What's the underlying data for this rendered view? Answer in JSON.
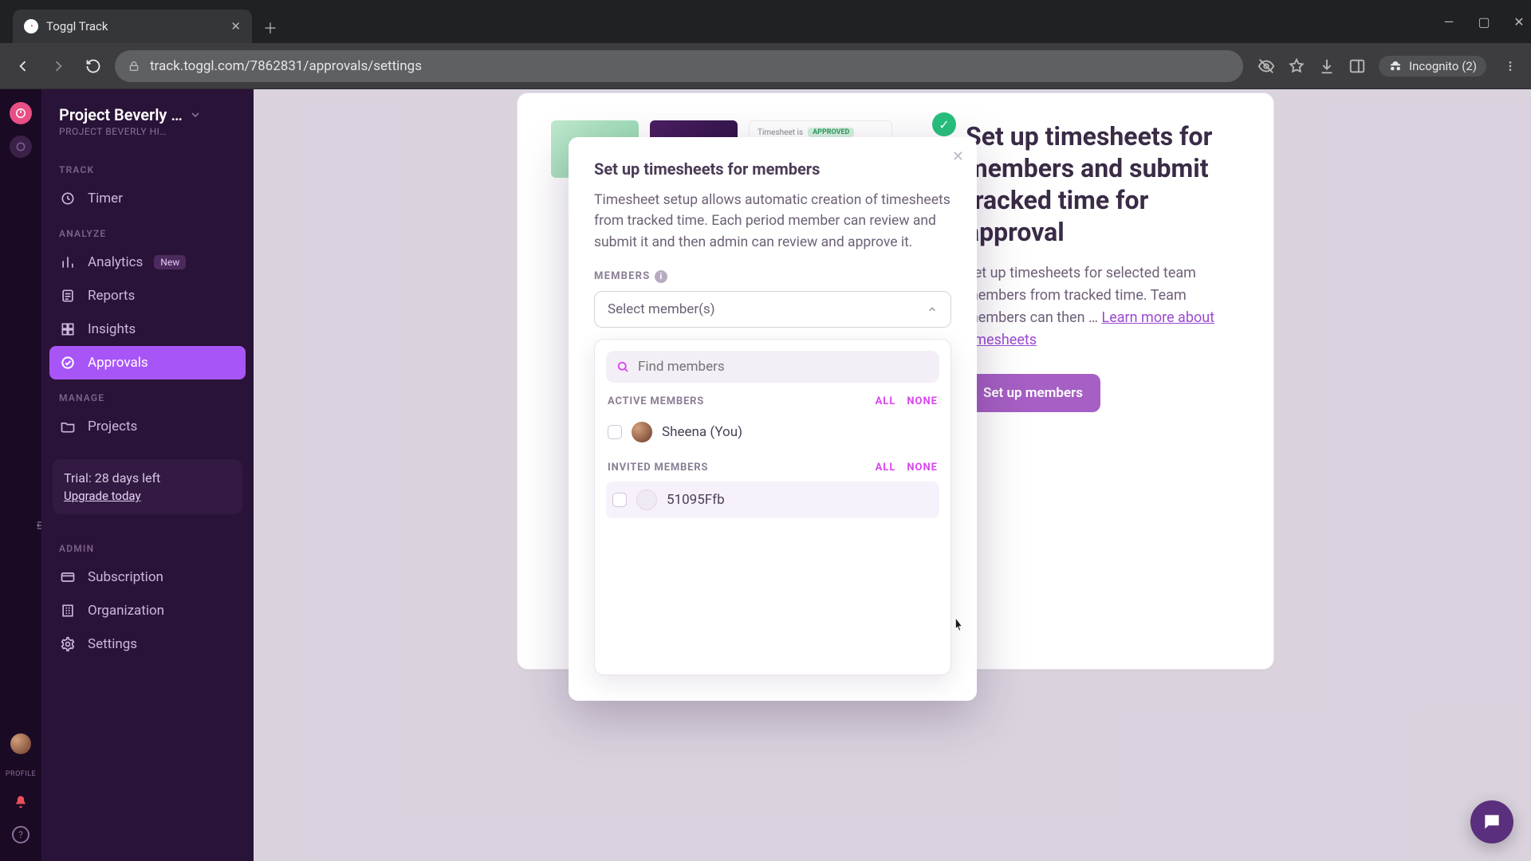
{
  "browser": {
    "tab_title": "Toggl Track",
    "url": "track.toggl.com/7862831/approvals/settings",
    "incognito_label": "Incognito (2)"
  },
  "workspace": {
    "name": "Project Beverly …",
    "sub": "PROJECT BEVERLY HI…"
  },
  "sections": {
    "track": "TRACK",
    "analyze": "ANALYZE",
    "manage": "MANAGE",
    "admin": "ADMIN"
  },
  "nav": {
    "timer": "Timer",
    "analytics": "Analytics",
    "analytics_badge": "New",
    "reports": "Reports",
    "insights": "Insights",
    "approvals": "Approvals",
    "projects": "Projects",
    "subscription": "Subscription",
    "organization": "Organization",
    "settings": "Settings"
  },
  "trial": {
    "line1": "Trial: 28 days left",
    "line2": "Upgrade today"
  },
  "rail": {
    "profile_label": "PROFILE"
  },
  "page": {
    "heading": "Set up timesheets for members and submit tracked time for approval",
    "body": "Set up timesheets for selected team members from tracked time. Team members can then …",
    "link": "Learn more about timesheets",
    "cta": "Set up members",
    "status_chip": "Timesheet is",
    "status_value": "APPROVED"
  },
  "modal": {
    "title": "Set up timesheets for members",
    "body": "Timesheet setup allows automatic creation of timesheets from tracked time. Each period member can review and submit it and then admin can review and approve it.",
    "members_label": "MEMBERS",
    "select_placeholder": "Select member(s)",
    "find_placeholder": "Find members",
    "active_label": "ACTIVE MEMBERS",
    "invited_label": "INVITED MEMBERS",
    "all": "ALL",
    "none": "NONE",
    "active_member": "Sheena (You)",
    "invited_member": "51095Ffb"
  }
}
